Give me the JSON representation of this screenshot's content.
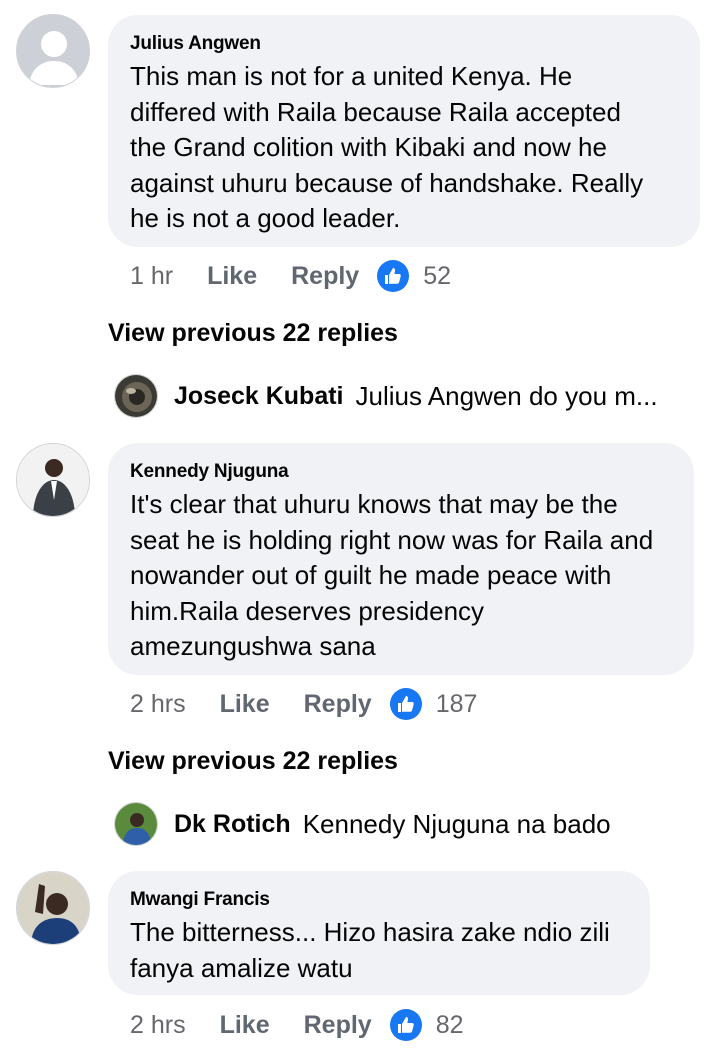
{
  "comments": [
    {
      "author": "Julius Angwen",
      "lines": [
        "This man is not for a united  Kenya. He",
        "differed  with  Raila  because  Raila  accepted",
        "the Grand  colition  with Kibaki  and now he",
        "against  uhuru  because of handshake. Really",
        "he is not  a good  leader."
      ],
      "time": "1 hr",
      "like_label": "Like",
      "reply_label": "Reply",
      "reaction_count": "52",
      "view_previous": "View previous 22 replies",
      "reply": {
        "name": "Joseck Kubati",
        "text": "Julius Angwen do you m..."
      }
    },
    {
      "author": "Kennedy Njuguna",
      "lines": [
        "It's clear that uhuru knows that may be the",
        "seat he is holding right now was for Raila and",
        "nowander out of guilt he made peace with",
        "him.Raila deserves presidency",
        "amezungushwa sana"
      ],
      "time": "2 hrs",
      "like_label": "Like",
      "reply_label": "Reply",
      "reaction_count": "187",
      "view_previous": "View previous 22 replies",
      "reply": {
        "name": "Dk Rotich",
        "text": "Kennedy Njuguna na bado"
      }
    },
    {
      "author": "Mwangi Francis",
      "lines": [
        "The bitterness... Hizo hasira zake ndio zili",
        "fanya amalize watu"
      ],
      "time": "2 hrs",
      "like_label": "Like",
      "reply_label": "Reply",
      "reaction_count": "82"
    }
  ],
  "colors": {
    "bubble": "#f0f2f5",
    "like_blue": "#1877f2",
    "secondary_text": "#65676b"
  }
}
